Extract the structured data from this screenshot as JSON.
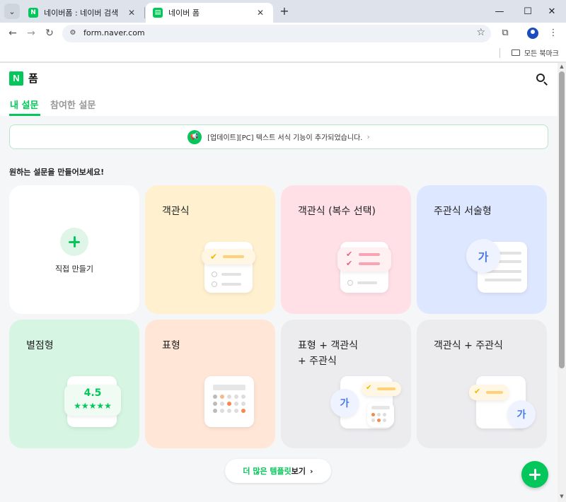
{
  "browser": {
    "tabs": [
      {
        "title": "네이버폼 : 네이버 검색",
        "favicon": "N",
        "active": false
      },
      {
        "title": "네이버 폼",
        "favicon": "form",
        "active": true
      }
    ],
    "url": "form.naver.com",
    "bookmark_folder": "모든 북마크"
  },
  "header": {
    "logo_letter": "N",
    "app_name": "폼",
    "tabs": [
      "내 설문",
      "참여한 설문"
    ]
  },
  "notice": {
    "text": "[업데이트][PC] 텍스트 서식 기능이 추가되었습니다."
  },
  "section_title": "원하는 설문을 만들어보세요!",
  "cards": [
    {
      "title": "",
      "label": "직접 만들기",
      "bg": "#ffffff"
    },
    {
      "title": "객관식",
      "bg": "#fff1cf"
    },
    {
      "title": "객관식 (복수 선택)",
      "bg": "#ffe0e6"
    },
    {
      "title": "주관식 서술형",
      "bg": "#dde7ff"
    },
    {
      "title": "별점형",
      "bg": "#d6f5e2",
      "rating": "4.5"
    },
    {
      "title": "표형",
      "bg": "#ffe6d6"
    },
    {
      "title": "표형 + 객관식\n+ 주관식",
      "bg": "#ececef"
    },
    {
      "title": "객관식 + 주관식",
      "bg": "#ececef"
    }
  ],
  "ga_glyph": "가",
  "more_templates": {
    "green": "더 많은 템플릿",
    "rest": " 보기"
  },
  "colors": {
    "brand_green": "#03c75a"
  }
}
